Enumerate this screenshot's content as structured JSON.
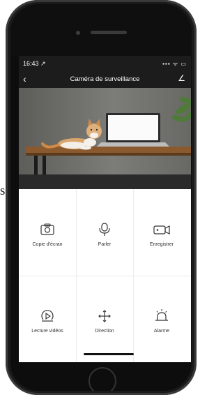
{
  "stray_text": "s",
  "status_bar": {
    "time": "16:43 ↗",
    "icons": "▪▪▪ ᯤ ▭"
  },
  "header": {
    "back_icon": "‹",
    "title": "Caméra de surveillance",
    "edit_icon": "∠"
  },
  "controls": [
    {
      "label": "Copie d'écran",
      "icon": "camera-icon"
    },
    {
      "label": "Parler",
      "icon": "microphone-icon"
    },
    {
      "label": "Enregistrer",
      "icon": "video-record-icon"
    },
    {
      "label": "Lecture vidéos",
      "icon": "playback-icon"
    },
    {
      "label": "Direction",
      "icon": "direction-icon"
    },
    {
      "label": "Alarme",
      "icon": "alarm-icon"
    }
  ],
  "colors": {
    "screen_header": "#1c1c1c",
    "grid_lines": "#ececec"
  }
}
